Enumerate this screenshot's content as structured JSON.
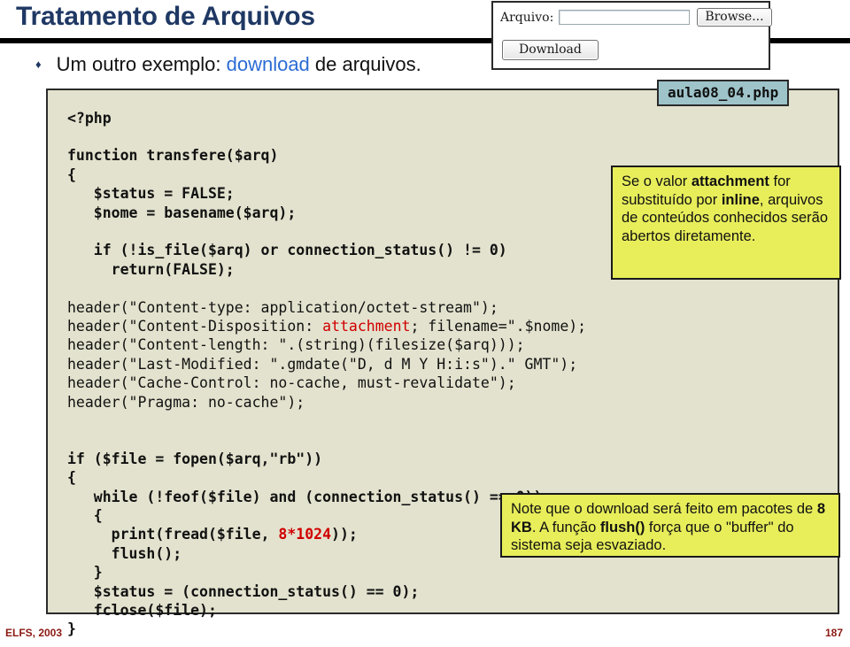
{
  "slide": {
    "title": "Tratamento de Arquivos",
    "bullet_marker": "♦",
    "bullet_prefix": "Um outro exemplo: ",
    "bullet_keyword": "download",
    "bullet_suffix": " de arquivos."
  },
  "form_widget": {
    "file_label": "Arquivo:",
    "file_value": "",
    "file_placeholder": "",
    "browse_label": "Browse...",
    "download_label": "Download"
  },
  "filename_tag": {
    "label": "aula08_04.php"
  },
  "code": {
    "lines": [
      "<?php",
      "",
      "function transfere($arq)",
      "{",
      "   $status = FALSE;",
      "   $nome = basename($arq);",
      "",
      "   if (!is_file($arq) or connection_status() != 0)",
      "     return(FALSE);",
      "",
      "header(\"Content-type: application/octet-stream\");",
      "header(\"Content-Disposition: attachment; filename=\".$nome);",
      "header(\"Content-length: \".(string)(filesize($arq)));",
      "header(\"Last-Modified: \".gmdate(\"D, d M Y H:i:s\").\" GMT\");",
      "header(\"Cache-Control: no-cache, must-revalidate\");",
      "header(\"Pragma: no-cache\");",
      "",
      "",
      "if ($file = fopen($arq,\"rb\"))",
      "{",
      "   while (!feof($file) and (connection_status() == 0))",
      "   {",
      "     print(fread($file, 8*1024));",
      "     flush();",
      "   }",
      "   $status = (connection_status() == 0);",
      "   fclose($file);",
      "}"
    ],
    "highlight_attachment": "attachment",
    "highlight_packet_size": "8*1024"
  },
  "callouts": {
    "attachment": {
      "part1": "Se o valor ",
      "bold1": "attachment",
      "part2": " for substituído por ",
      "bold2": "inline",
      "part3": ", arquivos de conteúdos conhecidos serão abertos diretamente."
    },
    "flush": {
      "part1": "Note que o download será feito em pacotes de ",
      "bold1": "8 KB",
      "part2": ". A função ",
      "bold2": "flush()",
      "part3": " força que o \"buffer\" do sistema seja esvaziado."
    }
  },
  "footer": {
    "left": "ELFS, 2003",
    "right": "187"
  },
  "colors": {
    "title": "#1F3864",
    "rule": "#000000",
    "link": "#2B6CD4",
    "code_bg": "#E3E2CE",
    "code_highlight": "#D00000",
    "callout_bg": "#E8EE5A",
    "tag_bg": "#9EC4CA",
    "footer": "#8B1A12"
  }
}
